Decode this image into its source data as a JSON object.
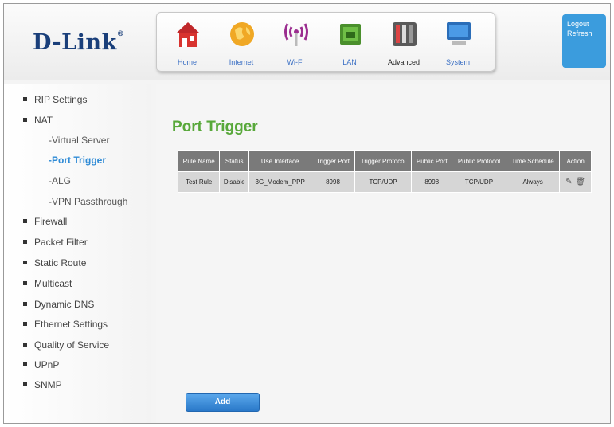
{
  "brand": {
    "name": "D-Link",
    "mark": "®"
  },
  "nav": [
    {
      "label": "Home",
      "icon": "home-icon"
    },
    {
      "label": "Internet",
      "icon": "internet-globe-icon"
    },
    {
      "label": "Wi-Fi",
      "icon": "wifi-icon"
    },
    {
      "label": "LAN",
      "icon": "lan-icon"
    },
    {
      "label": "Advanced",
      "icon": "advanced-tools-icon"
    },
    {
      "label": "System",
      "icon": "system-monitor-icon"
    }
  ],
  "top_buttons": {
    "logout": "Logout",
    "refresh": "Refresh"
  },
  "sidebar": {
    "items": [
      {
        "label": "RIP Settings"
      },
      {
        "label": "NAT"
      },
      {
        "label": "Firewall"
      },
      {
        "label": "Packet Filter"
      },
      {
        "label": "Static Route"
      },
      {
        "label": "Multicast"
      },
      {
        "label": "Dynamic DNS"
      },
      {
        "label": "Ethernet Settings"
      },
      {
        "label": "Quality of Service"
      },
      {
        "label": "UPnP"
      },
      {
        "label": "SNMP"
      }
    ],
    "nat_sub": [
      {
        "label": "-Virtual Server"
      },
      {
        "label": "-Port Trigger"
      },
      {
        "label": "-ALG"
      },
      {
        "label": "-VPN Passthrough"
      }
    ]
  },
  "page": {
    "title": "Port Trigger"
  },
  "table": {
    "headers": [
      "Rule Name",
      "Status",
      "Use Interface",
      "Trigger Port",
      "Trigger Protocol",
      "Public Port",
      "Public Protocol",
      "Time Schedule",
      "Action"
    ],
    "rows": [
      [
        "Test Rule",
        "Disable",
        "3G_Modem_PPP",
        "8998",
        "TCP/UDP",
        "8998",
        "TCP/UDP",
        "Always"
      ]
    ]
  },
  "add_button": "Add",
  "colors": {
    "title": "#58a83a",
    "link_active": "#2f8bd6",
    "header_bg": "#7a7a7a",
    "button": "#2a79c9",
    "logout_panel": "#3b9cdd"
  }
}
